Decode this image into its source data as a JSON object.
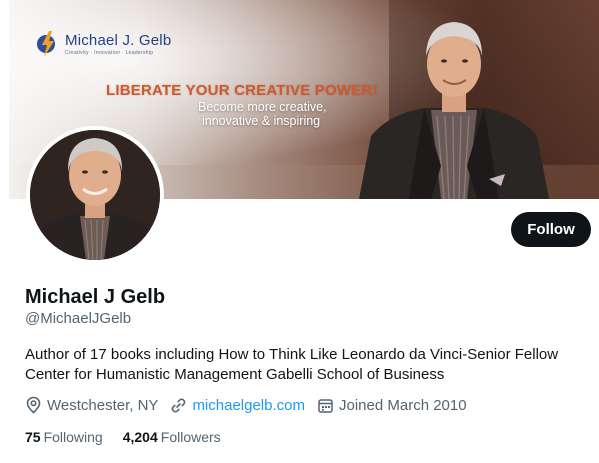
{
  "banner": {
    "logo_name": "Michael J. Gelb",
    "logo_tagline": "Creativity · Innovation · Leadership",
    "headline": "LIBERATE YOUR CREATIVE POWER!",
    "subline_1": "Become more creative,",
    "subline_2": "innovative & inspiring"
  },
  "profile": {
    "display_name": "Michael J Gelb",
    "handle": "@MichaelJGelb",
    "bio_line_1": "Author of 17 books including How to Think Like Leonardo da Vinci-Senior Fellow",
    "bio_line_2": "Center for Humanistic Management Gabelli School of Business",
    "location": "Westchester, NY",
    "website": "michaelgelb.com",
    "joined": "Joined March 2010",
    "following_count": "75",
    "following_label": "Following",
    "followers_count": "4,204",
    "followers_label": "Followers"
  },
  "actions": {
    "follow_label": "Follow"
  },
  "icons": {
    "location": "map-pin-icon",
    "website": "link-icon",
    "joined": "calendar-icon"
  },
  "colors": {
    "accent": "#1d9bf0",
    "button_bg": "#0f1419",
    "secondary_text": "#536471",
    "headline_orange": "#d0582a"
  }
}
